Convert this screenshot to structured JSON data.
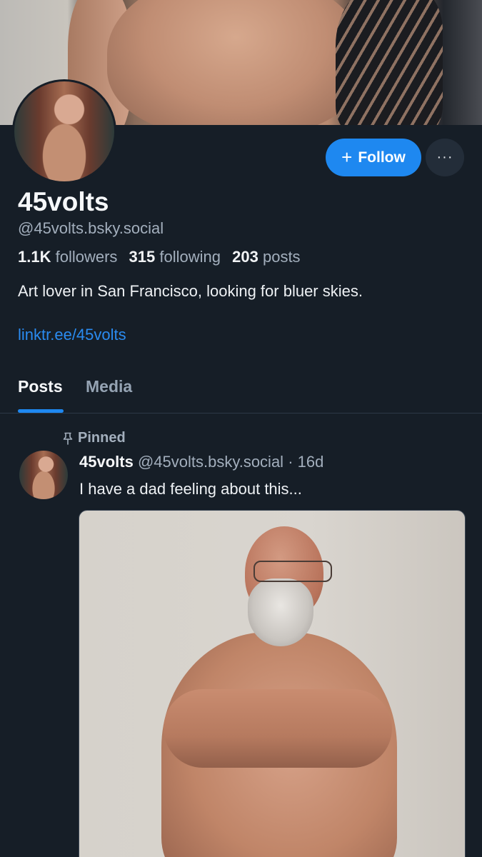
{
  "profile": {
    "display_name": "45volts",
    "handle": "@45volts.bsky.social",
    "stats": {
      "followers_count": "1.1K",
      "followers_label": "followers",
      "following_count": "315",
      "following_label": "following",
      "posts_count": "203",
      "posts_label": "posts"
    },
    "bio": "Art lover in San Francisco, looking for bluer skies.",
    "link": "linktr.ee/45volts"
  },
  "actions": {
    "follow_label": "Follow",
    "follow_icon": "+",
    "more_icon": "···"
  },
  "tabs": [
    {
      "label": "Posts",
      "active": true
    },
    {
      "label": "Media",
      "active": false
    }
  ],
  "post": {
    "pinned_label": "Pinned",
    "author_name": "45volts",
    "author_handle": "@45volts.bsky.social",
    "separator": "·",
    "time": "16d",
    "text": "I have a dad feeling about this..."
  },
  "colors": {
    "background": "#161e27",
    "accent": "#1e88f0",
    "muted_text": "#a3afbd"
  }
}
